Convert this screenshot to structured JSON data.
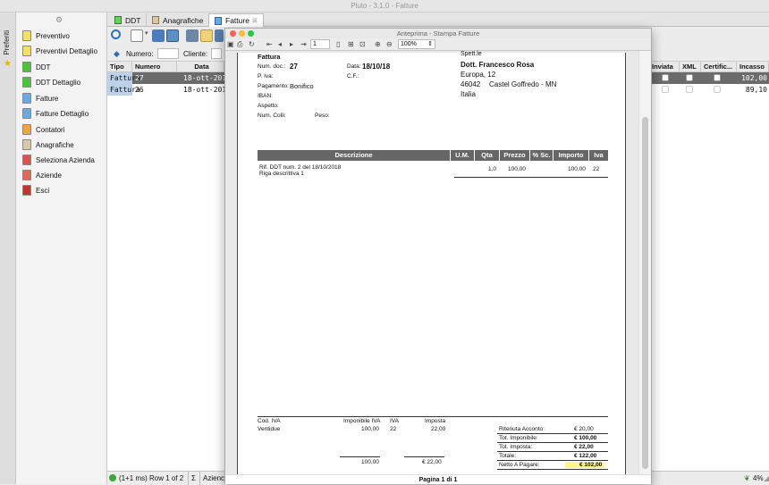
{
  "app": {
    "title": "Pluto - 3,1.0 - Fatture",
    "preferiti_label": "Preferiti"
  },
  "menu": {
    "items": [
      {
        "label": "Preventivo",
        "icon": "document-yellow-icon",
        "color": "#f2e25e"
      },
      {
        "label": "Preventivi Dettaglio",
        "icon": "document-yellow-icon",
        "color": "#f2e25e"
      },
      {
        "label": "DDT",
        "icon": "document-green-icon",
        "color": "#4bc43c"
      },
      {
        "label": "DDT Dettaglio",
        "icon": "document-green-icon",
        "color": "#4bc43c"
      },
      {
        "label": "Fatture",
        "icon": "document-blue-icon",
        "color": "#6aa8e8"
      },
      {
        "label": "Fatture Dettaglio",
        "icon": "document-blue-icon",
        "color": "#6aa8e8"
      },
      {
        "label": "Contatori",
        "icon": "counter-icon",
        "color": "#f2a53a"
      },
      {
        "label": "Anagrafiche",
        "icon": "address-card-icon",
        "color": "#d9c8a8"
      },
      {
        "label": "Seleziona Azienda",
        "icon": "building-select-icon",
        "color": "#d9534f"
      },
      {
        "label": "Aziende",
        "icon": "building-icon",
        "color": "#e06a5a"
      },
      {
        "label": "Esci",
        "icon": "exit-door-icon",
        "color": "#c0392b"
      }
    ]
  },
  "tabs": [
    {
      "label": "DDT"
    },
    {
      "label": "Anagrafiche"
    },
    {
      "label": "Fatture"
    }
  ],
  "filter": {
    "numero_label": "Numero:",
    "cliente_label": "Cliente:"
  },
  "grid": {
    "headers_left": [
      "Tipo ...",
      "Numero",
      "Data"
    ],
    "headers_right": [
      "Inviata",
      "XML",
      "Certific...",
      "Incasso"
    ],
    "rows": [
      {
        "tipo": "Fattura",
        "numero": "27",
        "data": "18-ott-2018",
        "incasso": "102,00"
      },
      {
        "tipo": "Fattura",
        "numero": "26",
        "data": "18-ott-2018",
        "incasso": "89,10"
      }
    ]
  },
  "status": {
    "text": "(1+1 ms) Row 1 of 2",
    "sigma": "Σ",
    "azienda": "Azienc",
    "right_pct": "4%"
  },
  "dialog": {
    "title": "Anteprima - Stampa Fatture",
    "page_input": "1",
    "zoom": "100%",
    "footer": "Pagina 1 di 1",
    "doc": {
      "type_label": "Fattura",
      "num_doc_label": "Num. doc.:",
      "num_doc": "27",
      "data_label": "Data:",
      "data": "18/10/18",
      "piva_label": "P. Iva:",
      "cf_label": "C.F.:",
      "pagamento_label": "Pagamento:",
      "pagamento": "Bonifico",
      "iban_label": "IBAN:",
      "aspetto_label": "Aspetto:",
      "colli_label": "Num. Colli:",
      "peso_label": "Peso:",
      "spett_label": "Spett.le",
      "cliente_nome": "Dott. Francesco Rosa",
      "cliente_via": "Europa, 12",
      "cliente_cap": "46042",
      "cliente_citta": "Castel Goffredo - MN",
      "cliente_paese": "Italia",
      "table_headers": [
        "Descrizione",
        "U.M.",
        "Qta",
        "Prezzo",
        "% Sc.",
        "Importo",
        "Iva"
      ],
      "righe": [
        {
          "descrizione": "Rif. DDT num. 2 del 18/10/2018",
          "descrizione2": "Riga descrittiva 1",
          "um": "",
          "qta": "1,0",
          "prezzo": "100,00",
          "sc": "",
          "importo": "100,00",
          "iva": "22"
        }
      ],
      "iva_headers": [
        "Cod. IVA",
        "Imponibile IVA",
        "IVA",
        "Imposta"
      ],
      "iva_row": {
        "cod": "Ventidue",
        "imponibile": "100,00",
        "iva": "22",
        "imposta": "22,00"
      },
      "iva_totals": {
        "imponibile": "100,00",
        "imposta": "€ 22,00"
      },
      "totals": [
        {
          "label": "Ritenuta Acconto:",
          "value": "€ 20,00"
        },
        {
          "label": "Tot. Imponibile:",
          "value": "€ 100,00"
        },
        {
          "label": "Tot. Imposta:",
          "value": "€ 22,00"
        },
        {
          "label": "Totale:",
          "value": "€ 122,00"
        },
        {
          "label": "Netto A Pagare:",
          "value": "€ 102,00"
        }
      ],
      "netto_highlight": "#fdf48a"
    }
  }
}
